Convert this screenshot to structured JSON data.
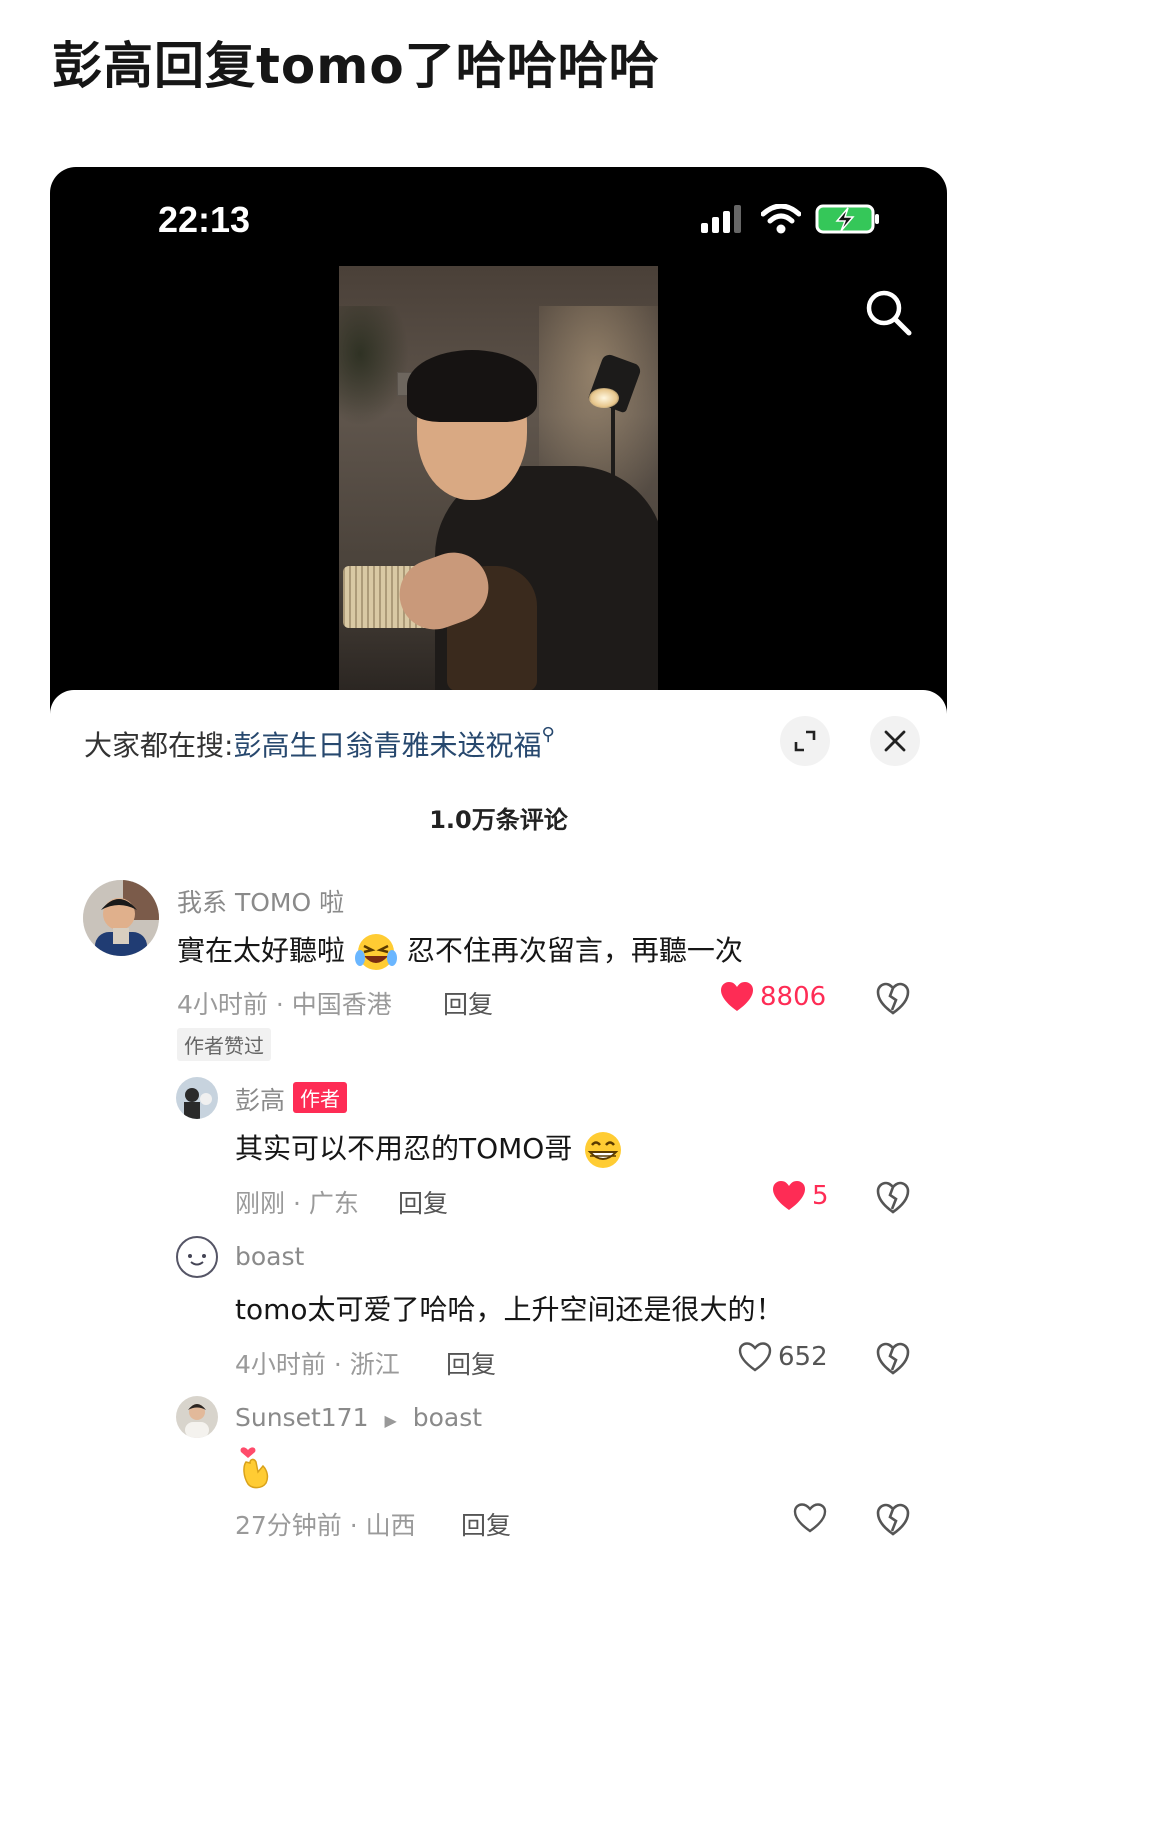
{
  "post": {
    "title": "彭高回复tomo了哈哈哈哈"
  },
  "status_bar": {
    "time": "22:13"
  },
  "icons": {
    "search": "search-icon",
    "signal": "signal-icon",
    "wifi": "wifi-icon",
    "battery": "battery-charging-icon",
    "expand": "expand-icon",
    "close": "close-icon",
    "heart": "heart-icon",
    "dislike": "broken-heart-icon"
  },
  "colors": {
    "like_red": "#fe2c55",
    "link_blue": "#27486e",
    "author_badge": "#fe2c55"
  },
  "panel": {
    "hot_search_prefix": "大家都在搜:",
    "hot_search_keyword": "彭高生日翁青雅未送祝福",
    "comment_count": "1.0万条评论"
  },
  "comments": [
    {
      "username": "我系 TOMO 啦",
      "text": "實在太好聽啦",
      "text_after_emoji": " 忍不住再次留言，再聽一次",
      "meta": "4小时前 · 中国香港",
      "reply_label": "回复",
      "likes": "8806",
      "liked": true,
      "tag": "作者赞过"
    },
    {
      "username": "彭高",
      "badge": "作者",
      "text": "其实可以不用忍的TOMO哥",
      "meta": "刚刚 · 广东",
      "reply_label": "回复",
      "likes": "5",
      "liked": true
    },
    {
      "username": "boast",
      "text": "tomo太可爱了哈哈，上升空间还是很大的！",
      "meta": "4小时前 · 浙江",
      "reply_label": "回复",
      "likes": "652",
      "liked": false
    },
    {
      "username": "Sunset171",
      "reply_to": "boast",
      "text": "",
      "meta": "27分钟前 · 山西",
      "reply_label": "回复",
      "likes": "",
      "liked": false
    }
  ]
}
